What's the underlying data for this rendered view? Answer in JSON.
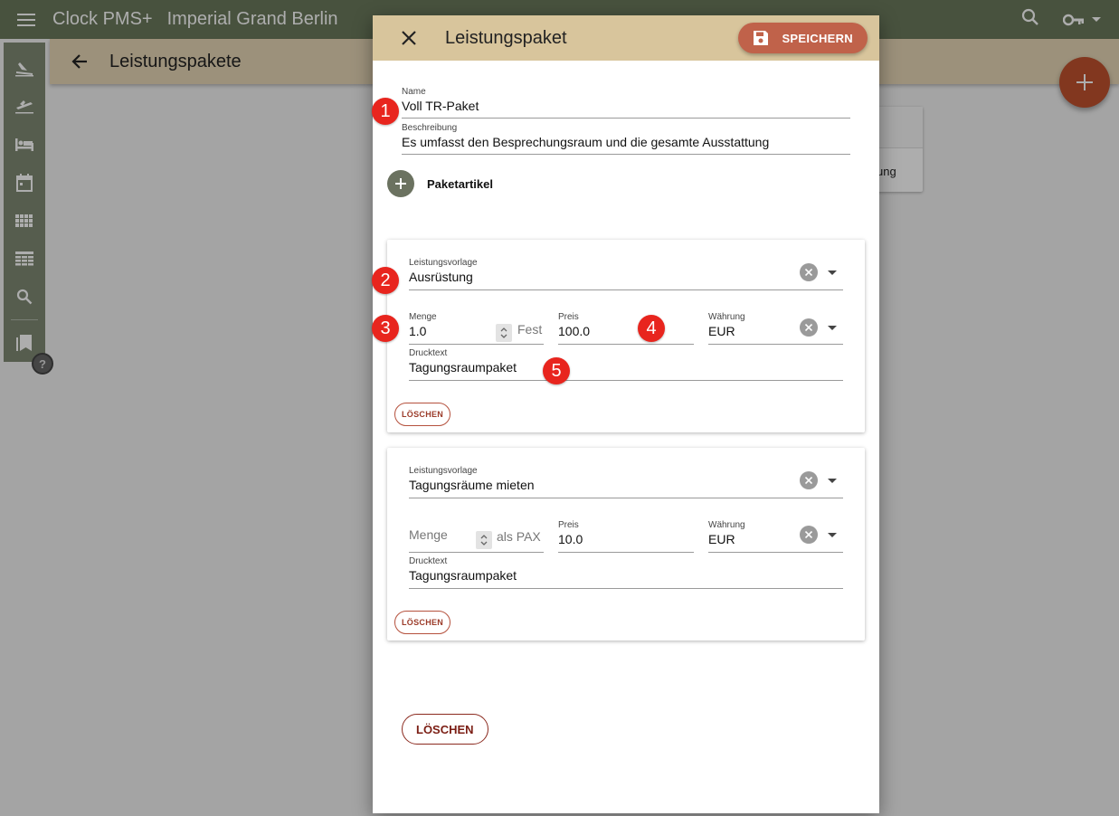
{
  "app": {
    "title": "Clock PMS+",
    "hotel": "Imperial Grand Berlin"
  },
  "subheader": {
    "title": "Leistungspakete"
  },
  "background_card": {
    "text": "ung"
  },
  "dialog": {
    "title": "Leistungspaket",
    "save_label": "SPEICHERN",
    "name_label": "Name",
    "name_value": "Voll TR-Paket",
    "desc_label": "Beschreibung",
    "desc_value": "Es umfasst den Besprechungsraum und die gesamte Ausstattung",
    "add_item_label": "Paketartikel",
    "items": [
      {
        "template_label": "Leistungsvorlage",
        "template_value": "Ausrüstung",
        "qty_label": "Menge",
        "qty_value": "1.0",
        "qty_suffix": "Fest",
        "price_label": "Preis",
        "price_value": "100.0",
        "currency_label": "Währung",
        "currency_value": "EUR",
        "print_label": "Drucktext",
        "print_value": "Tagungsraumpaket",
        "delete_label": "LÖSCHEN"
      },
      {
        "template_label": "Leistungsvorlage",
        "template_value": "Tagungsräume mieten",
        "qty_placeholder": "Menge",
        "qty_suffix": "als PAX",
        "price_label": "Preis",
        "price_value": "10.0",
        "currency_label": "Währung",
        "currency_value": "EUR",
        "print_label": "Drucktext",
        "print_value": "Tagungsraumpaket",
        "delete_label": "LÖSCHEN"
      }
    ],
    "delete_label": "LÖSCHEN"
  },
  "markers": [
    "1",
    "2",
    "3",
    "4",
    "5"
  ],
  "help_badge": "?",
  "colors": {
    "topbar": "#6b7a5c",
    "subheader": "#e6d6b6",
    "dialog_header": "#d8c59c",
    "accent": "#c0624a",
    "marker": "#e8251e"
  }
}
